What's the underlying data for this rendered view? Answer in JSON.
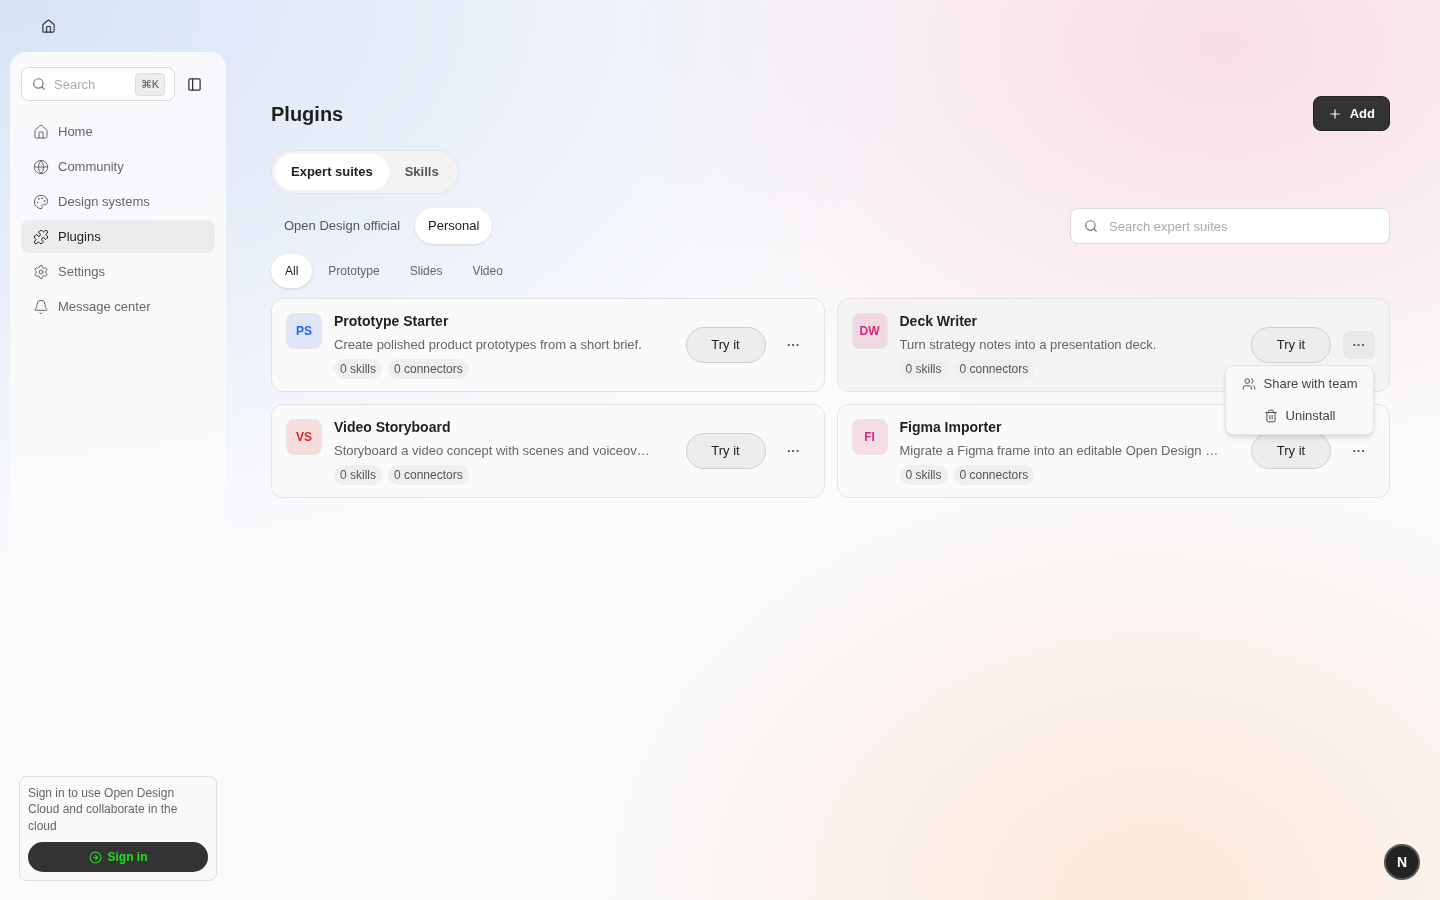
{
  "sidebar": {
    "search": {
      "placeholder": "Search",
      "shortcut": "⌘K"
    },
    "items": [
      {
        "label": "Home",
        "selected": false
      },
      {
        "label": "Community",
        "selected": false
      },
      {
        "label": "Design systems",
        "selected": false
      },
      {
        "label": "Plugins",
        "selected": true
      },
      {
        "label": "Settings",
        "selected": false
      },
      {
        "label": "Message center",
        "selected": false
      }
    ],
    "sign_in_card": {
      "text": "Sign in to use Open Design Cloud and collaborate in the cloud",
      "button": "Sign in"
    }
  },
  "page": {
    "title": "Plugins",
    "add_button": "Add",
    "tabs": [
      {
        "label": "Expert suites",
        "selected": true
      },
      {
        "label": "Skills",
        "selected": false
      }
    ],
    "sources": [
      {
        "label": "Open Design official",
        "selected": false
      },
      {
        "label": "Personal",
        "selected": true
      }
    ],
    "search": {
      "placeholder": "Search expert suites"
    },
    "filters": [
      {
        "label": "All",
        "selected": true
      },
      {
        "label": "Prototype",
        "selected": false
      },
      {
        "label": "Slides",
        "selected": false
      },
      {
        "label": "Video",
        "selected": false
      }
    ],
    "plugins": [
      {
        "initials": "PS",
        "color": "#2563eb",
        "name": "Prototype Starter",
        "description": "Create polished product prototypes from a short brief.",
        "skills": "0 skills",
        "connectors": "0 connectors",
        "try": "Try it",
        "more": "···",
        "hovered": false
      },
      {
        "initials": "DW",
        "color": "#db2777",
        "name": "Deck Writer",
        "description": "Turn strategy notes into a presentation deck.",
        "skills": "0 skills",
        "connectors": "0 connectors",
        "try": "Try it",
        "more": "···",
        "hovered": true,
        "menu": [
          "Share with team",
          "Uninstall"
        ]
      },
      {
        "initials": "VS",
        "color": "#dc2626",
        "name": "Video Storyboard",
        "description": "Storyboard a video concept with scenes and voiceov…",
        "skills": "0 skills",
        "connectors": "0 connectors",
        "try": "Try it",
        "more": "···",
        "hovered": false
      },
      {
        "initials": "FI",
        "color": "#db2777",
        "name": "Figma Importer",
        "description": "Migrate a Figma frame into an editable Open Design …",
        "skills": "0 skills",
        "connectors": "0 connectors",
        "try": "Try it",
        "more": "···",
        "hovered": false
      }
    ]
  },
  "corner_button": "N"
}
